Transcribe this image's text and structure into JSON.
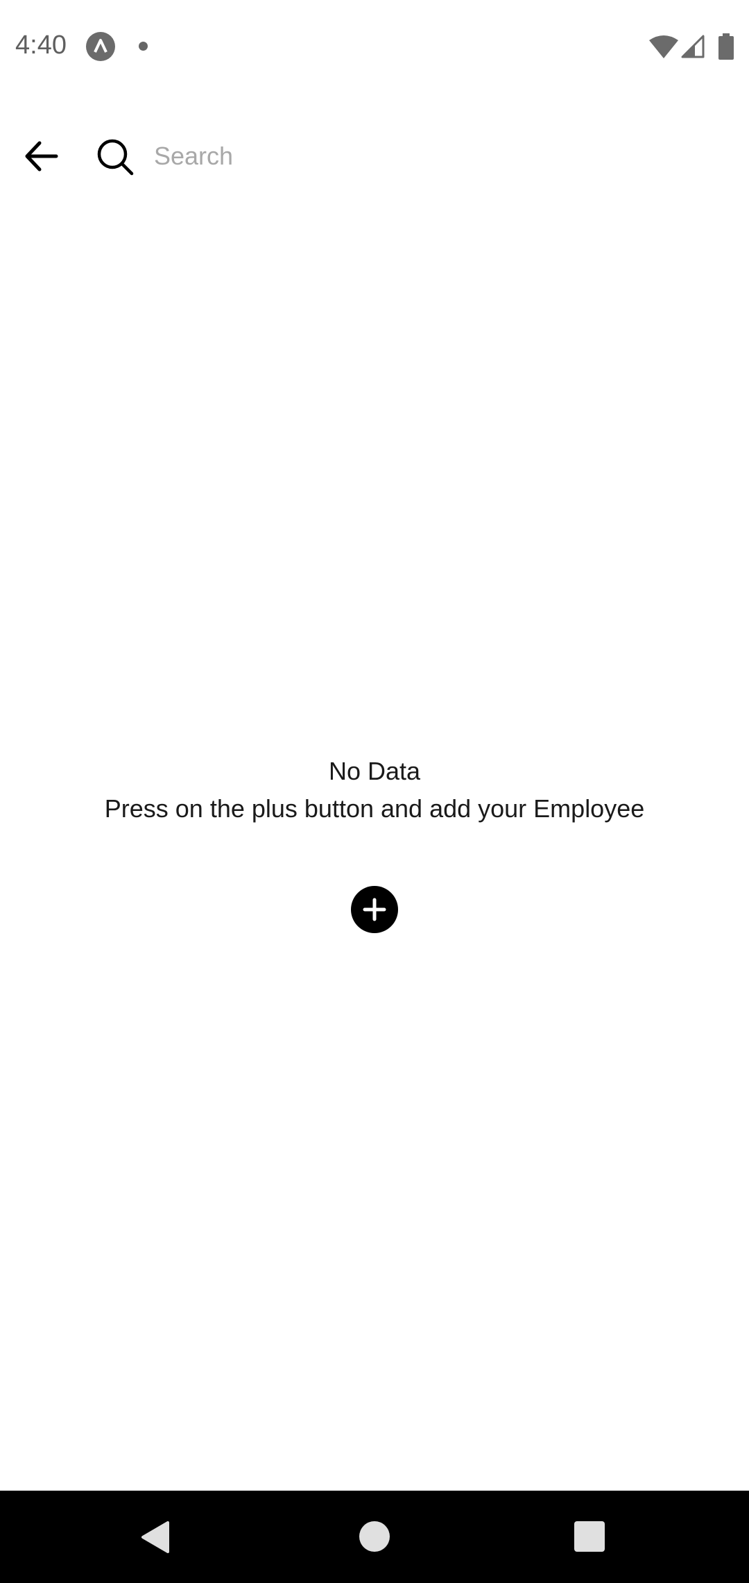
{
  "status_bar": {
    "time": "4:40",
    "icons": [
      "app-notification-icon",
      "notification-dot-icon",
      "wifi-icon",
      "cell-signal-icon",
      "battery-icon"
    ]
  },
  "toolbar": {
    "back_icon": "arrow-back-icon",
    "search_icon": "search-icon",
    "search_placeholder": "Search",
    "search_value": ""
  },
  "empty_state": {
    "title": "No Data",
    "subtitle": "Press on the plus button and add your Employee",
    "add_icon": "plus-circle-icon"
  },
  "navigation_bar": {
    "icons": [
      "nav-back-icon",
      "nav-home-icon",
      "nav-recents-icon"
    ]
  },
  "colors": {
    "background": "#ffffff",
    "text": "#1a1a1a",
    "placeholder": "#a8a8a8",
    "nav_bar": "#000000"
  }
}
